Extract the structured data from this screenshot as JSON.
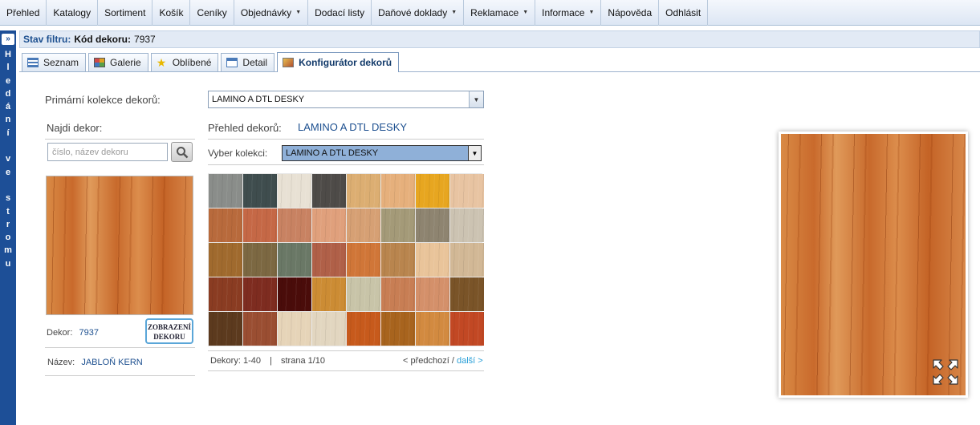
{
  "menu": {
    "items": [
      {
        "label": "Přehled",
        "dropdown": false
      },
      {
        "label": "Katalogy",
        "dropdown": false
      },
      {
        "label": "Sortiment",
        "dropdown": false
      },
      {
        "label": "Košík",
        "dropdown": false
      },
      {
        "label": "Ceníky",
        "dropdown": false
      },
      {
        "label": "Objednávky",
        "dropdown": true
      },
      {
        "label": "Dodací listy",
        "dropdown": false
      },
      {
        "label": "Daňové doklady",
        "dropdown": true
      },
      {
        "label": "Reklamace",
        "dropdown": true
      },
      {
        "label": "Informace",
        "dropdown": true
      },
      {
        "label": "Nápověda",
        "dropdown": false
      },
      {
        "label": "Odhlásit",
        "dropdown": false
      }
    ]
  },
  "sidebar": {
    "vertical_text": "Hledání ve stromu"
  },
  "filter": {
    "label": "Stav filtru:",
    "key": "Kód dekoru:",
    "value": "7937"
  },
  "tabs": [
    {
      "label": "Seznam",
      "icon": "list-icon",
      "active": false
    },
    {
      "label": "Galerie",
      "icon": "gallery-icon",
      "active": false
    },
    {
      "label": "Oblíbené",
      "icon": "star-icon",
      "active": false
    },
    {
      "label": "Detail",
      "icon": "detail-icon",
      "active": false
    },
    {
      "label": "Konfigurátor dekorů",
      "icon": "image-icon",
      "active": true
    }
  ],
  "form": {
    "primary_label": "Primární kolekce dekorů:",
    "primary_value": "LAMINO A DTL DESKY",
    "find_label": "Najdi dekor:",
    "search_placeholder": "číslo, název dekoru",
    "overview_label": "Přehled dekorů:",
    "overview_value": "LAMINO A DTL DESKY",
    "collection_label": "Vyber kolekci:",
    "collection_value": "LAMINO A DTL DESKY"
  },
  "decor": {
    "code_label": "Dekor:",
    "code": "7937",
    "name_label": "Název:",
    "name": "JABLOŇ KERN",
    "zoom_button": "ZOBRAZENÍ DEKORU"
  },
  "pagination": {
    "range_label": "Dekory:",
    "range": "1-40",
    "separator": "|",
    "page_label": "strana",
    "page": "1/10",
    "prev": "< předchozí",
    "slash": "/",
    "next": "další >"
  },
  "swatches": [
    "#8a8d8a",
    "#3f4d4e",
    "#e8e1d4",
    "#4e4b48",
    "#dcae72",
    "#e6b07c",
    "#e7a620",
    "#e8c4a2",
    "#b86a3c",
    "#c56846",
    "#c88262",
    "#e0a07c",
    "#d6a074",
    "#a49a78",
    "#8e8470",
    "#ccc3b2",
    "#a06a2e",
    "#7c6842",
    "#6a7866",
    "#b06048",
    "#d07638",
    "#b9854e",
    "#e9c49a",
    "#d2b896",
    "#8a3c22",
    "#7e2c20",
    "#4a0c0a",
    "#cc8c34",
    "#c8c4a8",
    "#c87e54",
    "#d4906a",
    "#7a5428",
    "#5c3a1e",
    "#9a4e32",
    "#e6d4b8",
    "#e2d6c0",
    "#c75a1c",
    "#a8641e",
    "#d28a40",
    "#c24824"
  ],
  "colors": {
    "accent": "#1c4f8f",
    "sidebar": "#1d4f97",
    "link_next": "#2aa0d8",
    "wood": "#d27a3a"
  }
}
